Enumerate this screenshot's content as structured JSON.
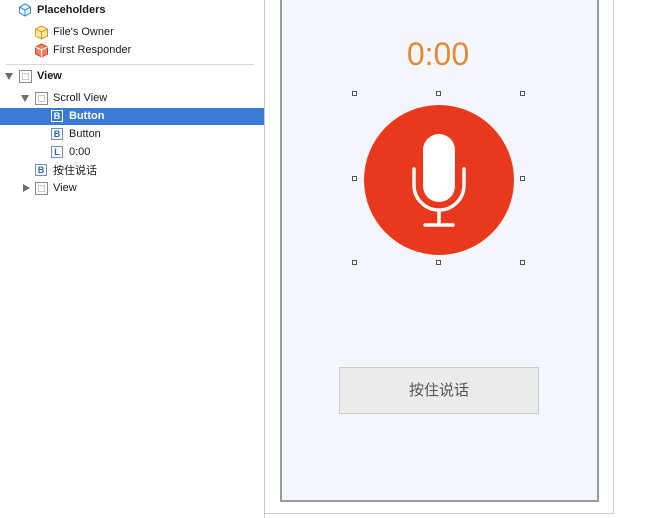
{
  "outline": {
    "placeholders_label": "Placeholders",
    "files_owner_label": "File's Owner",
    "first_responder_label": "First Responder",
    "view_label": "View",
    "scroll_view_label": "Scroll View",
    "button1_icon": "B",
    "button1_label": "Button",
    "button2_icon": "B",
    "button2_label": "Button",
    "label_icon": "L",
    "label_label": "0:00",
    "hold_item_icon": "B",
    "hold_item_label": "按住说话",
    "subview_label": "View"
  },
  "canvas": {
    "timer": "0:00",
    "hold_button": "按住说话"
  },
  "colors": {
    "selection": "#3a7bd5",
    "mic_button": "#e8391c",
    "timer_text": "#e08a3a",
    "screen_bg": "#f3f6fb"
  },
  "icons": {
    "placeholders": "cube-icon",
    "files_owner": "cube-icon",
    "first_responder": "first-responder-icon",
    "view": "view-icon",
    "button": "button-icon",
    "label": "label-icon",
    "mic": "microphone-icon"
  }
}
